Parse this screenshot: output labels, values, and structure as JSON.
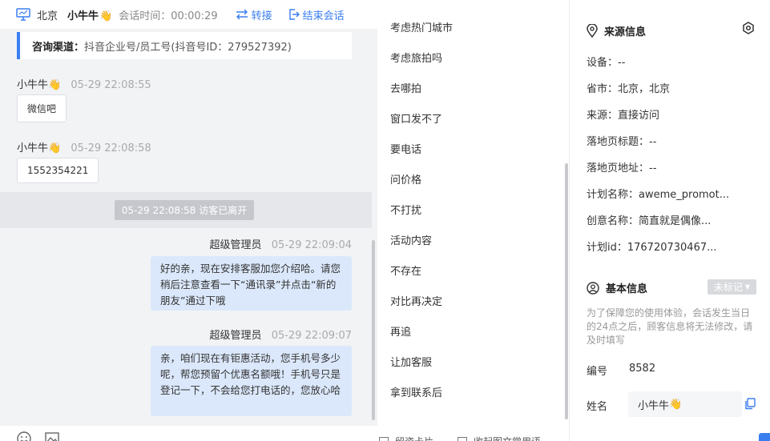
{
  "header": {
    "city": "北京",
    "visitor_name": "小牛牛",
    "visitor_emoji": "👋",
    "session_time": "会话时间：00:00:29",
    "transfer_label": "转接",
    "end_label": "结束会话"
  },
  "chat": {
    "source_label": "咨询渠道：",
    "source_value": "抖音企业号/员工号(抖音号ID：279527392)",
    "messages": [
      {
        "sender": "小牛牛",
        "time": "05-29 22:08:55",
        "text": "微信吧"
      },
      {
        "sender": "小牛牛",
        "time": "05-29 22:08:58",
        "text": "1552354221"
      }
    ],
    "system_notice": "05-29 22:08:58 访客已离开",
    "agent_messages": [
      {
        "sender": "超级管理员",
        "time": "05-29 22:09:04",
        "text": "好的亲，现在安排客服加您介绍哈。请您稍后注意查看一下“通讯录”并点击“新的朋友”通过下哦"
      },
      {
        "sender": "超级管理员",
        "time": "05-29 22:09:07",
        "text": "亲，咱们现在有钜惠活动，您手机号多少呢，帮您预留个优惠名额哦！手机号只是登记一下，不会给您打电话的，您放心哈"
      }
    ]
  },
  "replies": {
    "items": [
      "考虑热门城市",
      "考虑旅拍吗",
      "去哪拍",
      "窗口发不了",
      "要电话",
      "问价格",
      "不打扰",
      "活动内容",
      "不存在",
      "对比再决定",
      "再追",
      "让加客服",
      "拿到联系后"
    ],
    "bottom_left": "留资卡片",
    "bottom_right": "收起图文常用语"
  },
  "info": {
    "source_title": "来源信息",
    "rows": [
      "设备：--",
      "省市：北京，北京",
      "来源：直接访问",
      "落地页标题：--",
      "落地页地址：--",
      "计划名称：aweme_promot...",
      "创意名称：简直就是偶像...",
      "计划id：176720730467..."
    ],
    "basic_title": "基本信息",
    "tag_label": "未标记",
    "notice": "为了保障您的使用体验，会话发生当日的24点之后，顾客信息将无法修改，请及时填写",
    "id_label": "编号",
    "id_value": "8582",
    "name_label": "姓名",
    "name_value": "小牛牛",
    "name_emoji": "👋"
  },
  "colors": {
    "accent": "#3a7ef0",
    "agent_bubble": "#dbe8fb"
  }
}
